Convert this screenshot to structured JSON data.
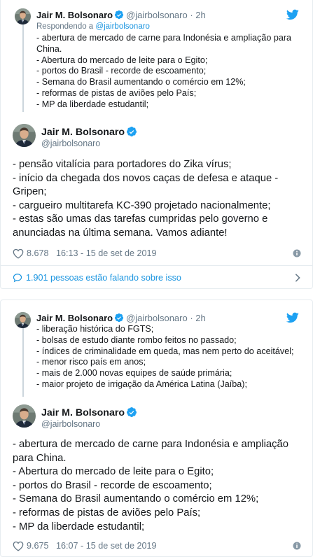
{
  "tweet1": {
    "quoted": {
      "name": "Jair M. Bolsonaro",
      "handle": "@jairbolsonaro",
      "time": "2h",
      "replying_label": "Respondendo a",
      "replying_to": "@jairbolsonaro",
      "lines": [
        "- abertura de mercado de carne para Indonésia e ampliação para China.",
        "- Abertura do mercado de leite para o Egito;",
        "- portos do Brasil - recorde de escoamento;",
        "- Semana do Brasil aumentando o comércio em 12%;",
        "- reformas de pistas de aviões pelo País;",
        "- MP da liberdade estudantil;"
      ]
    },
    "author": {
      "name": "Jair M. Bolsonaro",
      "handle": "@jairbolsonaro"
    },
    "lines": [
      "- pensão vitalícia para portadores do Zika vírus;",
      "- início da chegada dos novos caças de defesa e ataque -",
      "Gripen;",
      "- cargueiro multitarefa KC-390 projetado nacionalmente;",
      "- estas são umas das tarefas cumpridas pelo governo e",
      "anunciadas na última semana. Vamos adiante!"
    ],
    "likes": "8.678",
    "timestamp": "16:13 - 15 de set de 2019",
    "talking": "1.901 pessoas estão falando sobre isso"
  },
  "tweet2": {
    "quoted": {
      "name": "Jair M. Bolsonaro",
      "handle": "@jairbolsonaro",
      "time": "2h",
      "lines": [
        "- liberação histórica do FGTS;",
        "- bolsas de estudo diante rombo feitos no passado;",
        "- índices de criminalidade em queda, mas nem perto do aceitável;",
        "- menor risco país em anos;",
        "- mais de 2.000 novas equipes de saúde primária;",
        "- maior projeto de irrigação da América Latina (Jaíba);"
      ]
    },
    "author": {
      "name": "Jair M. Bolsonaro",
      "handle": "@jairbolsonaro"
    },
    "lines": [
      "- abertura de mercado de carne para Indonésia e ampliação",
      "para China.",
      "- Abertura do mercado de leite para o Egito;",
      "- portos do Brasil - recorde de escoamento;",
      "- Semana do Brasil aumentando o comércio em 12%;",
      "- reformas de pistas de aviões pelo País;",
      "- MP da liberdade estudantil;"
    ],
    "likes": "9.675",
    "timestamp": "16:07 - 15 de set de 2019"
  },
  "icons": {
    "verified": "verified-badge-icon",
    "bird": "twitter-bird-icon",
    "heart": "heart-icon",
    "info": "info-icon",
    "bubble": "speech-bubble-icon",
    "chevron": "chevron-right-icon"
  },
  "colors": {
    "link": "#1b95e0",
    "verified": "#1da1f2",
    "muted": "#657786",
    "border": "#e6ecf0",
    "thread_line": "#ccd6dd"
  }
}
